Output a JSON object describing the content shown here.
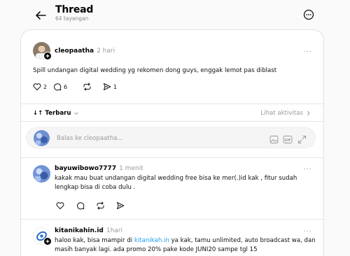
{
  "header": {
    "title": "Thread",
    "views": "64 tayangan"
  },
  "post": {
    "username": "cleopaatha",
    "time": "2 hari",
    "text": "Spill undangan digital wedding yg rekomen dong guys, enggak lemot pas diblast",
    "likes": "2",
    "comments": "6",
    "shares": "1"
  },
  "filter": {
    "sort_label": "Terbaru",
    "activity_label": "Lihat aktivitas"
  },
  "reply_box": {
    "placeholder": "Balas ke cleopaatha..."
  },
  "replies": [
    {
      "username": "bayuwibowo7777",
      "time": "1 menit",
      "text": "kakak mau buat undangan digital wedding free bisa ke mer(.)id kak , fitur sudah lengkap bisa di coba dulu ."
    },
    {
      "username": "kitanikahin.id",
      "time": "1hari",
      "text_before": "haloo kak, bisa mampir di ",
      "link": "kitanikah.in",
      "text_after": " ya kak, tamu unlimited, auto broadcast wa, dan masih banyak lagi. ada promo 20% pake kode JUNI20 sampe tgl 15"
    }
  ]
}
